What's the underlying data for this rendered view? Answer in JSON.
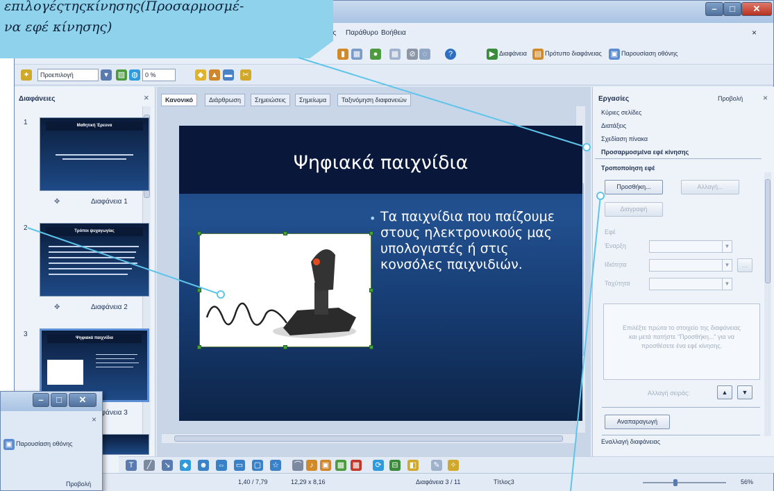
{
  "callout": {
    "text": "επιλογέςτηςκίνησης(Προσαρμοσμέ- να εφέ κίνησης)"
  },
  "menu": {
    "items": [
      "ης",
      "Παράθυρο",
      "Βοήθεια"
    ]
  },
  "toolbar": {
    "transition_label": "Διαφάνεια",
    "template_label": "Πρότυπο διαφάνειας",
    "slideshow_label": "Παρουσίαση οθόνης",
    "preset_combo": "Προεπιλογή",
    "percent_combo": "0 %"
  },
  "slides_pane": {
    "title": "Διαφάνειες",
    "slides": [
      {
        "number": "1",
        "caption": "Διαφάνεια 1",
        "thumb_title": "Μαθητική Έρευνα"
      },
      {
        "number": "2",
        "caption": "Διαφάνεια 2",
        "thumb_title": "Τρόποι ψυχαγωγίας"
      },
      {
        "number": "3",
        "caption": "Διαφάνεια 3",
        "thumb_title": "Ψηφιακά παιχνίδια"
      }
    ]
  },
  "view_tabs": [
    "Κανονικό",
    "Διάρθρωση",
    "Σημειώσεις",
    "Σημείωμα",
    "Ταξινόμηση διαφανειών"
  ],
  "slide": {
    "title": "Ψηφιακά παιχνίδια",
    "bullet": "Τα παιχνίδια που παίζουμε στους ηλεκτρονικούς μας υπολογιστές ή στις κονσόλες παιχνιδιών."
  },
  "tasks_pane": {
    "title": "Εργασίες",
    "view_label": "Προβολή",
    "sections": [
      "Κύριες σελίδες",
      "Διατάξεις",
      "Σχεδίαση πίνακα"
    ],
    "active_section": "Προσαρμοσμένα εφέ κίνησης",
    "modify_label": "Τροποποίηση εφέ",
    "add_button": "Προσθήκη...",
    "change_button": "Αλλαγή...",
    "remove_button": "Διαγραφή",
    "effect_label": "Εφέ",
    "start_label": "Έναρξη",
    "property_label": "Ιδιότητα",
    "speed_label": "Ταχύτητα",
    "hint": "Επιλέξτε πρώτα το στοιχείο της διαφάνειας και μετά πατήστε \"Προσθήκη...\" για να προσθέσετε ένα εφέ κίνησης.",
    "order_label": "Αλλαγή σειράς:",
    "play_button": "Αναπαραγωγή",
    "footer_item": "Εναλλαγή διαφάνειας"
  },
  "status_bar": {
    "position": "1,40 / 7,79",
    "size": "12,29 x 8,16",
    "slide_counter": "Διαφάνεια 3 / 11",
    "layout": "Τίτλος3",
    "zoom": "56%"
  },
  "inset": {
    "slideshow_label": "Παρουσίαση οθόνης",
    "view_label": "Προβολή"
  },
  "colors": {
    "callout": "#8ed2ec",
    "slide_header": "#09183a",
    "slide_body": "#1e4a86",
    "window": "#dfe9f5",
    "close_button": "#c8432e"
  }
}
